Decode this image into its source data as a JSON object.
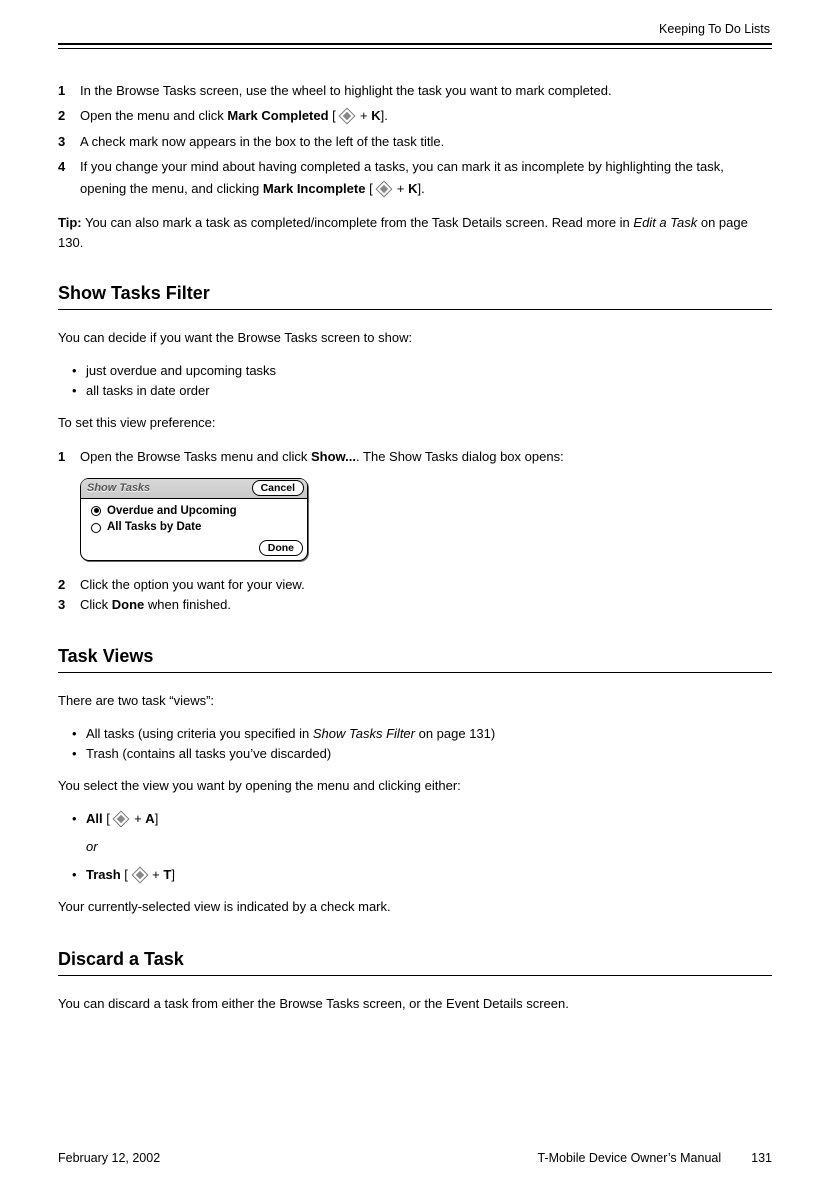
{
  "header": {
    "running_head": "Keeping To Do Lists"
  },
  "steps1": [
    {
      "n": "1",
      "text": "In the Browse Tasks screen, use the wheel to highlight the task you want to mark completed."
    },
    {
      "n": "2",
      "pre": "Open the menu and click ",
      "bold1": "Mark Completed",
      "mid": " [ ",
      "key": "K",
      "post": "]."
    },
    {
      "n": "3",
      "text": "A check mark now appears in the box to the left of the task title."
    },
    {
      "n": "4",
      "pre": "If you change your mind about having completed a tasks, you can mark it as incomplete by highlighting the task, opening the menu, and clicking ",
      "bold1": "Mark Incomplete",
      "mid": " [ ",
      "key": "K",
      "post": "]."
    }
  ],
  "tip": {
    "label": "Tip:",
    "pre": " You can also mark a task as completed/incomplete from the Task Details screen. Read more in ",
    "italic": "Edit a Task",
    "post": " on page 130."
  },
  "h2a": "Show Tasks Filter",
  "filter_intro": "You can decide if you want the Browse Tasks screen to show:",
  "filter_bullets": [
    "just overdue and upcoming tasks",
    "all tasks in date order"
  ],
  "filter_set": "To set this view preference:",
  "filter_step1": {
    "n": "1",
    "pre": "Open the Browse Tasks menu and click ",
    "bold": "Show...",
    "post": ". The Show Tasks dialog box opens:"
  },
  "dialog": {
    "title": "Show Tasks",
    "cancel": "Cancel",
    "opt1": "Overdue and Upcoming",
    "opt2": "All Tasks by Date",
    "done": "Done"
  },
  "filter_step2": {
    "n": "2",
    "text": "Click the option you want for your view."
  },
  "filter_step3": {
    "n": "3",
    "pre": "Click ",
    "bold": "Done",
    "post": " when finished."
  },
  "h2b": "Task Views",
  "views_intro": "There are two task “views”:",
  "views_b1_pre": "All tasks (using criteria you specified in ",
  "views_b1_italic": "Show Tasks Filter",
  "views_b1_post": " on page 131)",
  "views_b2": "Trash (contains all tasks you’ve discarded)",
  "views_select": "You select the view you want by opening the menu and clicking either:",
  "views_all": {
    "bold": "All",
    "mid": " [ ",
    "key": "A",
    "post": "]"
  },
  "views_or": "or",
  "views_trash": {
    "bold": "Trash",
    "mid": " [ ",
    "key": "T",
    "post": "]"
  },
  "views_end": "Your currently-selected view is indicated by a check mark.",
  "h2c": "Discard a Task",
  "discard_text": "You can discard a task from either the Browse Tasks screen, or the Event Details screen.",
  "footer": {
    "date": "February 12, 2002",
    "title": "T-Mobile Device Owner’s Manual",
    "page": "131"
  },
  "plus": " + "
}
